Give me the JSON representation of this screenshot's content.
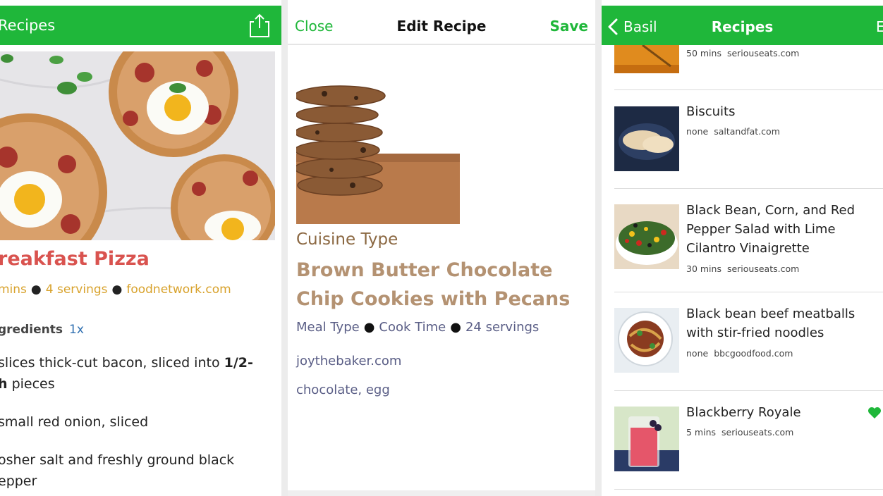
{
  "panel_left": {
    "nav_back_label": "Recipes",
    "icon_share": "share-icon",
    "title": "reakfast Pizza",
    "meta": [
      "mins",
      "4 servings",
      "foodnetwork.com"
    ],
    "ingredients_heading": "gredients",
    "ingredients_multiplier": "1x",
    "ingredients": [
      {
        "line1_pre": "slices thick-cut bacon, sliced into ",
        "line1_bold": "1/2-",
        "line2_bold": "h",
        "line2_post": " pieces"
      },
      {
        "line1_pre": "small red onion, sliced"
      },
      {
        "line1_pre": "osher salt and freshly ground black",
        "line2_post": "epper"
      }
    ],
    "accent_color": "#1fb73a",
    "title_color": "#d9534f",
    "meta_color": "#d8a22c"
  },
  "panel_middle": {
    "close_label": "Close",
    "title": "Edit Recipe",
    "save_label": "Save",
    "cuisine_label": "Cuisine Type",
    "recipe_title": "Brown Butter Chocolate Chip Cookies with Pecans",
    "meta": [
      "Meal Type",
      "Cook Time",
      "24 servings"
    ],
    "source": "joythebaker.com",
    "tags": "chocolate, egg"
  },
  "panel_right": {
    "back_label": "Basil",
    "title": "Recipes",
    "edit_label_partial": "E",
    "icon_back": "chevron-left-icon",
    "recipes": [
      {
        "name": "",
        "time": "50 mins",
        "source": "seriouseats.com",
        "favorite": false
      },
      {
        "name": "Biscuits",
        "time": "none",
        "source": "saltandfat.com",
        "favorite": false
      },
      {
        "name": "Black Bean, Corn, and Red Pepper Salad with Lime Cilantro Vinaigrette",
        "time": "30 mins",
        "source": "seriouseats.com",
        "favorite": false
      },
      {
        "name": "Black bean beef meatballs with stir-fried noodles",
        "time": "none",
        "source": "bbcgoodfood.com",
        "favorite": false
      },
      {
        "name": "Blackberry Royale",
        "time": "5 mins",
        "source": "seriouseats.com",
        "favorite": true
      }
    ]
  }
}
